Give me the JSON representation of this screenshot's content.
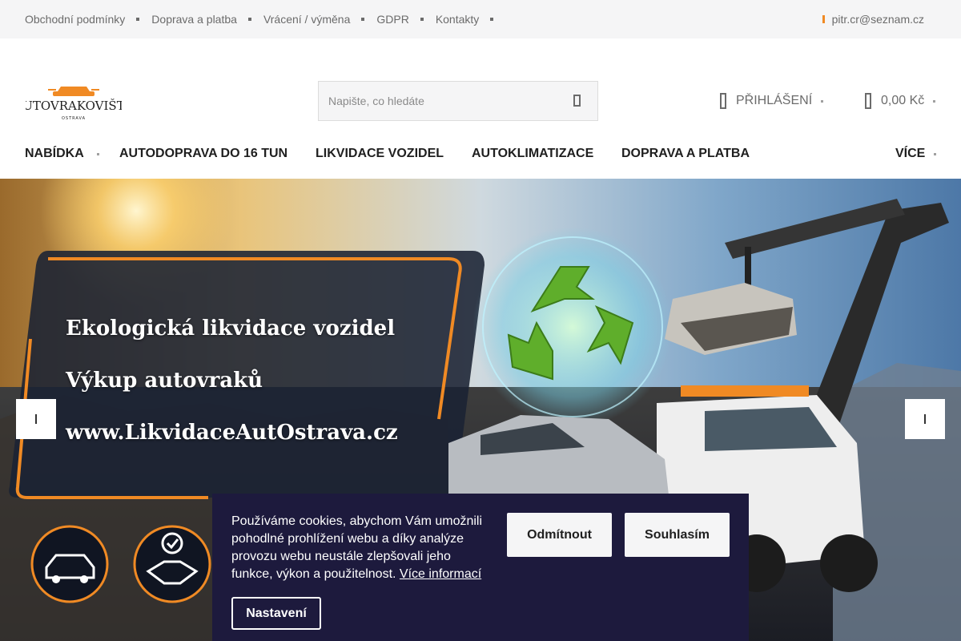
{
  "topbar": {
    "links": [
      "Obchodní podmínky",
      "Doprava a platba",
      "Vrácení / výměna",
      "GDPR",
      "Kontakty"
    ],
    "email": "pitr.cr@seznam.cz"
  },
  "header": {
    "logo_text": "AUTOVRAKOVIŠTĚ",
    "logo_subtext": "OSTRAVA",
    "search_placeholder": "Napište, co hledáte",
    "login_label": "PŘIHLÁŠENÍ",
    "cart_label": "0,00 Kč"
  },
  "nav": {
    "items": [
      "NABÍDKA",
      "AUTODOPRAVA DO 16 TUN",
      "LIKVIDACE VOZIDEL",
      "AUTOKLIMATIZACE",
      "DOPRAVA A PLATBA"
    ],
    "more_label": "VÍCE"
  },
  "hero": {
    "lines": [
      "Ekologická likvidace vozidel",
      "Výkup autovraků",
      "www.LikvidaceAutOstrava.cz"
    ]
  },
  "cookie": {
    "text": "Používáme cookies, abychom Vám umožnili pohodlné prohlížení webu a díky analýze provozu webu neustále zlepšovali jeho funkce, výkon a použitelnost.",
    "link": "Více informací",
    "decline": "Odmítnout",
    "accept": "Souhlasím",
    "settings": "Nastavení"
  },
  "colors": {
    "accent": "#f08a24",
    "cookie_bg": "#1d1a3d",
    "topbar_bg": "#f5f5f6"
  }
}
